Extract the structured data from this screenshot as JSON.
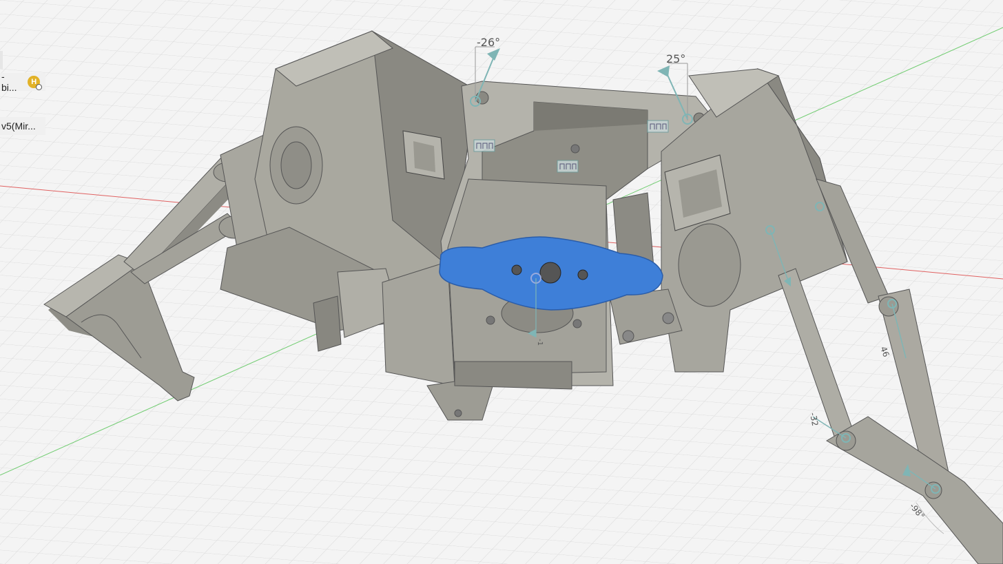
{
  "browser_tree": {
    "items": [
      {
        "label": "-bi..."
      },
      {
        "label": "v5(Mir..."
      }
    ],
    "badge_letter": "H"
  },
  "joint_angles": {
    "left_bracket": "-26°",
    "right_bracket": "25°",
    "leg_upper": "46",
    "leg_mid": "-32",
    "leg_lower": "-98°",
    "horn": "-1"
  },
  "colors": {
    "background": "#f4f4f4",
    "grid": "#dadada",
    "body": "#a9a89f",
    "body_dark": "#7c7b74",
    "selection": "#3e7fd8",
    "joint": "#7fb5b5",
    "x_axis": "#e04040",
    "y_axis": "#40c040"
  },
  "icons": [
    "rigid-group-icon",
    "joint-origin-icon",
    "user-avatar-icon"
  ]
}
